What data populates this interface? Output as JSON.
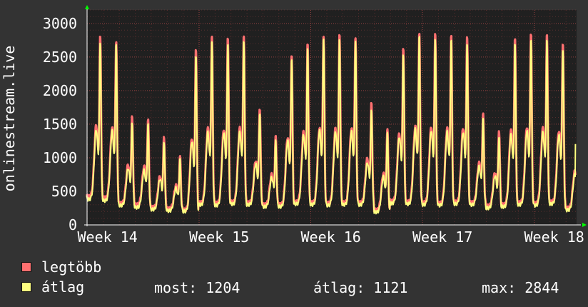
{
  "chart_data": {
    "type": "line",
    "ylabel": "onlinestream.live",
    "ylim": [
      0,
      3200
    ],
    "yticks": [
      0,
      500,
      1000,
      1500,
      2000,
      2500,
      3000
    ],
    "xticks": [
      "Week 14",
      "Week 15",
      "Week 16",
      "Week 17",
      "Week 18"
    ],
    "grid": true,
    "x_day_offset": 0.05,
    "series": [
      {
        "name": "legtöbb",
        "color": "#ff7070",
        "daily_peaks": [
          2780,
          2720,
          1600,
          1560,
          1300,
          1010,
          2600,
          2780,
          2780,
          2780,
          1730,
          1300,
          2530,
          2660,
          2820,
          2800,
          2790,
          1790,
          1430,
          2600,
          2840,
          2830,
          2800,
          2790,
          1640,
          1400,
          2740,
          2844,
          2800,
          2700,
          1460
        ],
        "daily_mins": [
          420,
          400,
          320,
          300,
          260,
          240,
          220,
          330,
          320,
          340,
          330,
          300,
          300,
          340,
          330,
          320,
          330,
          330,
          220,
          350,
          340,
          330,
          320,
          340,
          330,
          280,
          300,
          330,
          320,
          340,
          250
        ]
      },
      {
        "name": "átlag",
        "color": "#ffff80",
        "daily_peaks": [
          2700,
          2660,
          1520,
          1480,
          1240,
          960,
          2520,
          2700,
          2700,
          2700,
          1660,
          1240,
          2460,
          2600,
          2760,
          2740,
          2720,
          1700,
          1360,
          2530,
          2780,
          2770,
          2720,
          2700,
          1560,
          1320,
          2660,
          2760,
          2720,
          2600,
          1400
        ],
        "daily_mins": [
          380,
          360,
          290,
          260,
          230,
          210,
          200,
          300,
          290,
          310,
          300,
          270,
          270,
          310,
          300,
          290,
          300,
          300,
          190,
          320,
          310,
          300,
          290,
          310,
          300,
          250,
          270,
          300,
          290,
          310,
          220
        ],
        "end_value": 1204
      }
    ]
  },
  "legend": {
    "items": [
      {
        "label": "legtöbb",
        "color": "#ff7070"
      },
      {
        "label": "átlag",
        "color": "#ffff80"
      }
    ],
    "stats": {
      "most_label": "most:",
      "most_value": "1204",
      "atlag_label": "átlag:",
      "atlag_value": "1121",
      "max_label": "max:",
      "max_value": "2844"
    }
  },
  "colors": {
    "background": "#333333",
    "plot_bg": "#202020",
    "grid": "#8b3a3a",
    "axis": "#ffffff",
    "arrow": "#00ff00"
  }
}
